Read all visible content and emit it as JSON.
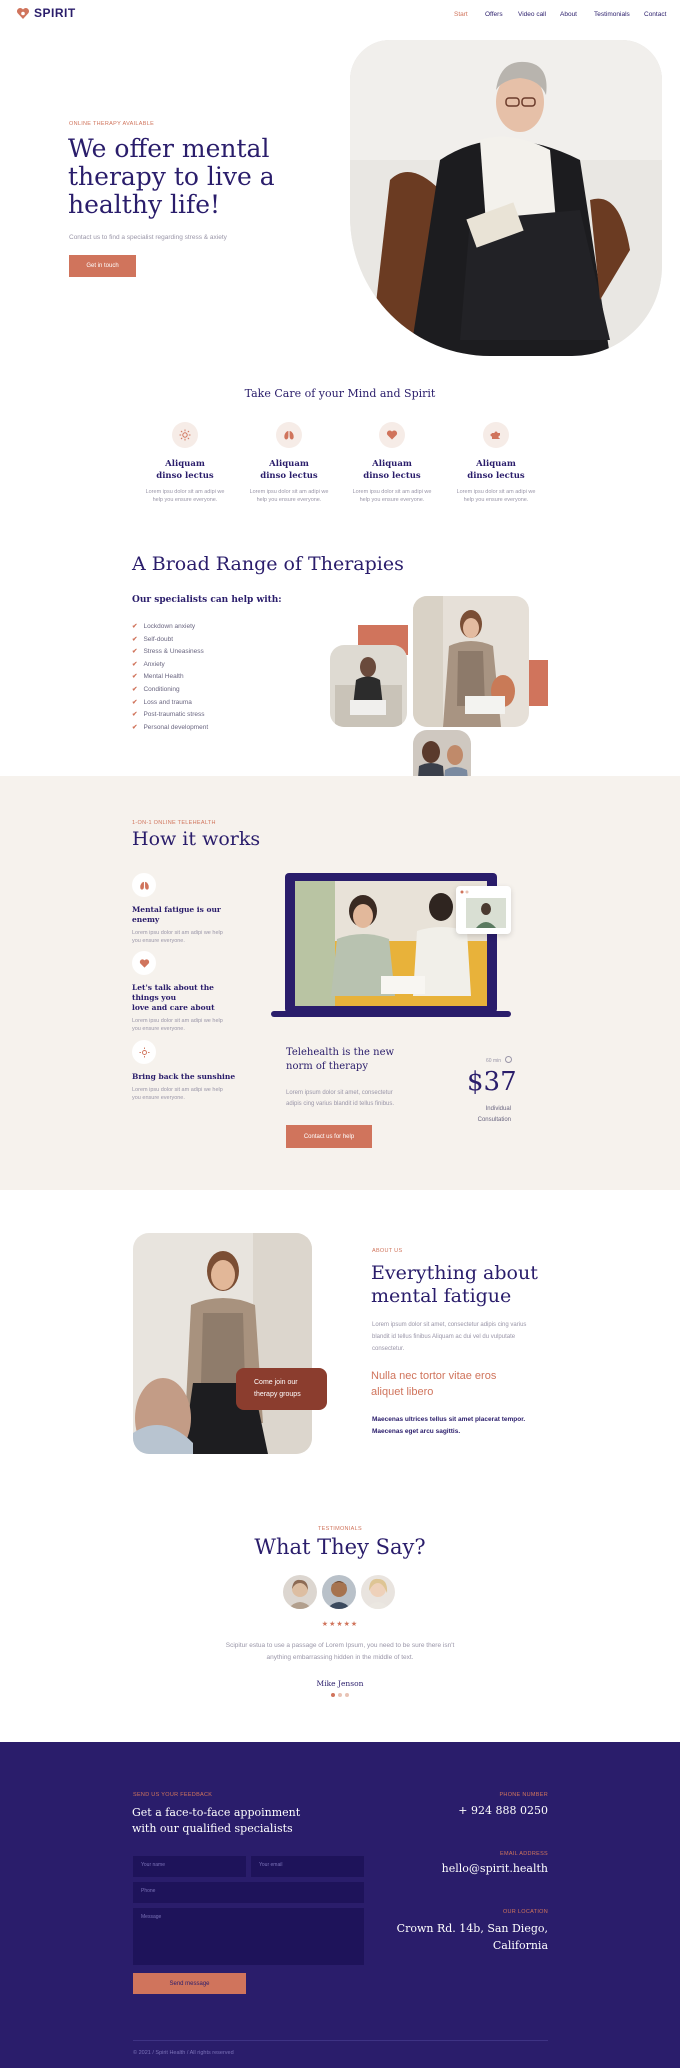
{
  "header": {
    "logo_text": "SPIRIT",
    "nav": [
      "Start",
      "Offers",
      "Video call",
      "About",
      "Testimonials",
      "Contact"
    ]
  },
  "hero": {
    "eyebrow": "ONLINE THERAPY AVAILABLE",
    "title_lines": [
      "We offer mental",
      "therapy to live a",
      "healthy life!"
    ],
    "subtitle": "Contact us to find a specialist regarding stress & axiety",
    "cta": "Get in touch"
  },
  "care": {
    "title": "Take Care of your Mind and Spirit",
    "items": [
      {
        "icon": "sun-icon",
        "title1": "Aliquam",
        "title2": "dinso lectus",
        "text1": "Lorem ipsu dolor sit am adipi we",
        "text2": "help you ensure everyone."
      },
      {
        "icon": "lungs-icon",
        "title1": "Aliquam",
        "title2": "dinso lectus",
        "text1": "Lorem ipsu dolor sit am adipi we",
        "text2": "help you ensure everyone."
      },
      {
        "icon": "heart-icon",
        "title1": "Aliquam",
        "title2": "dinso lectus",
        "text1": "Lorem ipsu dolor sit am adipi we",
        "text2": "help you ensure everyone."
      },
      {
        "icon": "puzzle-icon",
        "title1": "Aliquam",
        "title2": "dinso lectus",
        "text1": "Lorem ipsu dolor sit am adipi we",
        "text2": "help you ensure everyone."
      }
    ]
  },
  "therapies": {
    "title": "A Broad Range of Therapies",
    "subtitle": "Our specialists can help with:",
    "list": [
      "Lockdown anxiety",
      "Self-doubt",
      "Stress & Uneasiness",
      "Anxiety",
      "Mental Health",
      "Conditioning",
      "Loss and trauma",
      "Post-traumatic stress",
      "Personal development"
    ]
  },
  "how": {
    "eyebrow": "1-ON-1 ONLINE TELEHEALTH",
    "title": "How it works",
    "steps": [
      {
        "icon": "lungs-icon",
        "title1": "Mental fatigue is our enemy",
        "title2": "",
        "text1": "Lorem ipsu dolor sit am adipi we help",
        "text2": "you ensure everyone."
      },
      {
        "icon": "heart-icon",
        "title1": "Let's talk about the things you",
        "title2": "love and care about",
        "text1": "Lorem ipsu dolor sit am adipi we help",
        "text2": "you ensure everyone."
      },
      {
        "icon": "sun-icon",
        "title1": "Bring back the sunshine",
        "title2": "",
        "text1": "Lorem ipsu dolor sit am adipi we help",
        "text2": "you ensure everyone."
      }
    ],
    "tele_title1": "Telehealth is the new",
    "tele_title2": "norm of therapy",
    "tele_text1": "Lorem ipsum dolor sit amet, consectetur",
    "tele_text2": "adipis cing varius blandit id tellus finibus.",
    "cta": "Contact us for help",
    "price_caption": "60 min",
    "price": "$37",
    "price_label1": "Individual",
    "price_label2": "Consultation"
  },
  "about": {
    "eyebrow": "ABOUT US",
    "title1": "Everything about",
    "title2": "mental fatigue",
    "text1": "Lorem ipsum dolor sit amet, consectetur adipis cing varius",
    "text2": "blandit id tellus finibus Aliquam ac dui vel du vulputate",
    "text3": "consectetur.",
    "highlight1": "Nulla nec tortor vitae eros",
    "highlight2": "aliquet libero",
    "bold1": "Maecenas ultrices tellus sit amet placerat tempor.",
    "bold2": "Maecenas eget arcu sagittis.",
    "badge1": "Come join our",
    "badge2": "therapy groups"
  },
  "testimonials": {
    "eyebrow": "TESTIMONIALS",
    "title": "What They Say?",
    "stars": "★★★★★",
    "quote1": "Scipitur estua to use a passage of Lorem Ipsum, you need to be sure there isn't",
    "quote2": "anything embarrassing hidden in the middle of text.",
    "author": "Mike Jenson"
  },
  "footer": {
    "eyebrow": "SEND US YOUR FEEDBACK",
    "title1": "Get a face-to-face appoinment",
    "title2": "with our qualified specialists",
    "name_ph": "Your name",
    "email_ph": "Your email",
    "phone_ph": "Phone",
    "message_ph": "Message",
    "send": "Send message",
    "phone_label": "PHONE NUMBER",
    "phone": "+ 924 888 0250",
    "email_label": "EMAIL ADDRESS",
    "email": "hello@spirit.health",
    "location_label": "OUR LOCATION",
    "location1": "Crown Rd. 14b, San Diego,",
    "location2": "California",
    "copyright": "© 2021 / Spirit Health / All rights reserved"
  },
  "colors": {
    "navy": "#2a1d6b",
    "accent": "#d0745c",
    "cream": "#f6f2ed"
  }
}
